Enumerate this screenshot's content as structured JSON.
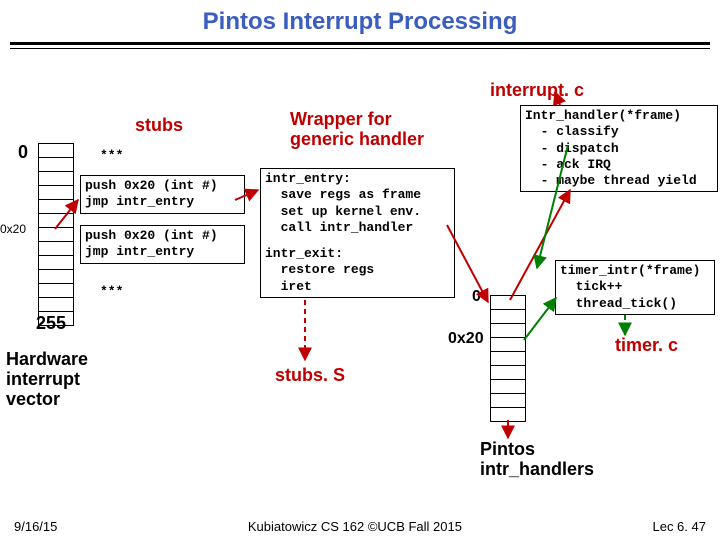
{
  "title": "Pintos Interrupt Processing",
  "interrupt_c_label": "interrupt. c",
  "stubs_label": "stubs",
  "stars_top": "***",
  "zero_label": "0",
  "ox20_left": "0x20",
  "stub0": {
    "l1": "push 0x20 (int #)",
    "l2": "jmp intr_entry"
  },
  "stub1": {
    "l1": "push 0x20 (int #)",
    "l2": "jmp intr_entry"
  },
  "stars_bot": "***",
  "n255": "255",
  "wrapper": {
    "l1": "Wrapper for",
    "l2": "generic handler"
  },
  "intr_entry": {
    "l1": "intr_entry:",
    "l2": "  save regs as frame",
    "l3": "  set up kernel env.",
    "l4": "  call intr_handler"
  },
  "intr_exit": {
    "l1": "intr_exit:",
    "l2": "  restore regs",
    "l3": "  iret"
  },
  "handler_table": {
    "zero": "0",
    "ox20": "0x20"
  },
  "intr_handler": {
    "l1": "Intr_handler(*frame)",
    "l2": "  - classify",
    "l3": "  - dispatch",
    "l4": "  - ack IRQ",
    "l5": "  - maybe thread yield"
  },
  "timer_intr": {
    "l1": "timer_intr(*frame)",
    "l2": "  tick++",
    "l3": "  thread_tick()"
  },
  "timer_c": "timer. c",
  "hw_vec": {
    "l1": "Hardware",
    "l2": "interrupt",
    "l3": "vector"
  },
  "stubs_s": "stubs. S",
  "pintos_handlers": {
    "l1": "Pintos",
    "l2": "intr_handlers"
  },
  "footer": {
    "date": "9/16/15",
    "center": "Kubiatowicz CS 162 ©UCB Fall 2015",
    "right": "Lec 6. 47"
  }
}
